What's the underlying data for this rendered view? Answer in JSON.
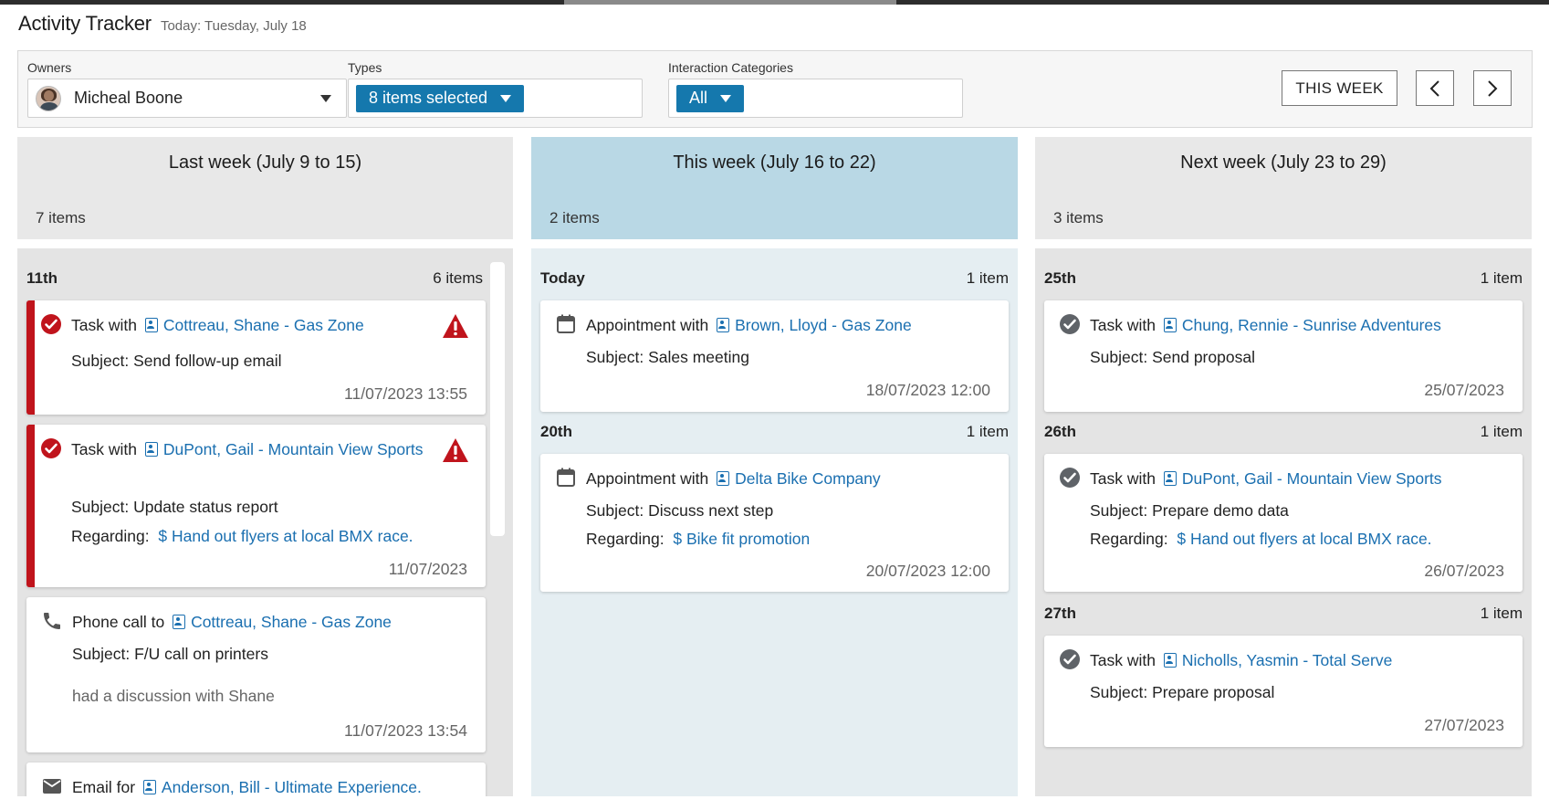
{
  "app": {
    "title": "Activity Tracker",
    "today": "Today: Tuesday, July 18"
  },
  "filters": {
    "owners": {
      "label": "Owners",
      "value": "Micheal Boone"
    },
    "types": {
      "label": "Types",
      "value": "8 items selected"
    },
    "categories": {
      "label": "Interaction Categories",
      "value": "All"
    }
  },
  "nav": {
    "this_week": "THIS WEEK",
    "prev": "‹",
    "next": "›"
  },
  "columns": [
    {
      "title": "Last week (July 9 to 15)",
      "count": "7 items",
      "days": [
        {
          "date": "11th",
          "count": "6 items",
          "items": [
            {
              "type": "task-overdue",
              "prefix": "Task with",
              "contact": "Cottreau, Shane - Gas Zone",
              "subject": "Subject: Send follow-up email",
              "date": "11/07/2023 13:55"
            },
            {
              "type": "task-overdue",
              "prefix": "Task with",
              "contact": "DuPont, Gail - Mountain View Sports",
              "subject": "Subject: Update status report",
              "regarding_label": "Regarding:",
              "regarding": "Hand out flyers at local BMX race.",
              "date": "11/07/2023"
            },
            {
              "type": "phone",
              "prefix": "Phone call to",
              "contact": "Cottreau, Shane - Gas Zone",
              "subject": "Subject: F/U call on printers",
              "note": "had a discussion with Shane",
              "date": "11/07/2023 13:54"
            },
            {
              "type": "email",
              "prefix": "Email for",
              "contact": "Anderson, Bill - Ultimate Experience."
            }
          ]
        }
      ]
    },
    {
      "title": "This week (July 16 to 22)",
      "count": "2 items",
      "days": [
        {
          "date": "Today",
          "count": "1 item",
          "items": [
            {
              "type": "appointment",
              "prefix": "Appointment with",
              "contact": "Brown, Lloyd - Gas Zone",
              "subject": "Subject: Sales meeting",
              "date": "18/07/2023 12:00"
            }
          ]
        },
        {
          "date": "20th",
          "count": "1 item",
          "items": [
            {
              "type": "appointment",
              "prefix": "Appointment with",
              "contact": "Delta Bike Company",
              "subject": "Subject: Discuss next step",
              "regarding_label": "Regarding:",
              "regarding": "Bike fit promotion",
              "date": "20/07/2023 12:00"
            }
          ]
        }
      ]
    },
    {
      "title": "Next week (July 23 to 29)",
      "count": "3 items",
      "days": [
        {
          "date": "25th",
          "count": "1 item",
          "items": [
            {
              "type": "task",
              "prefix": "Task with",
              "contact": "Chung, Rennie - Sunrise Adventures",
              "subject": "Subject: Send proposal",
              "date": "25/07/2023"
            }
          ]
        },
        {
          "date": "26th",
          "count": "1 item",
          "items": [
            {
              "type": "task",
              "prefix": "Task with",
              "contact": "DuPont, Gail - Mountain View Sports",
              "subject": "Subject: Prepare demo data",
              "regarding_label": "Regarding:",
              "regarding": "Hand out flyers at local BMX race.",
              "date": "26/07/2023"
            }
          ]
        },
        {
          "date": "27th",
          "count": "1 item",
          "items": [
            {
              "type": "task",
              "prefix": "Task with",
              "contact": "Nicholls, Yasmin - Total Serve",
              "subject": "Subject: Prepare proposal",
              "date": "27/07/2023"
            }
          ]
        }
      ]
    }
  ],
  "colors": {
    "accent": "#1578ad",
    "overdue": "#c0141c",
    "link": "#1a6fb0",
    "this_week_bg": "#b9d8e5"
  }
}
